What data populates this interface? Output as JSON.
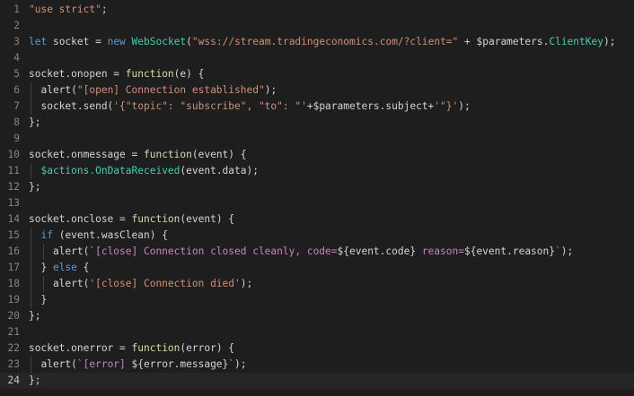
{
  "editor": {
    "language": "javascript",
    "active_line": 24,
    "colors": {
      "background": "#1e1e1e",
      "text": "#d4d4d4",
      "string": "#ce9178",
      "keyword": "#569cd6",
      "function": "#dcdcaa",
      "class": "#4ec9b0",
      "template_text": "#c586c0",
      "line_number": "#858585"
    },
    "lines": [
      {
        "n": 1,
        "guides": [],
        "tokens": [
          {
            "t": "\"use strict\"",
            "c": "str"
          },
          {
            "t": ";",
            "c": ""
          }
        ]
      },
      {
        "n": 2,
        "guides": [],
        "tokens": []
      },
      {
        "n": 3,
        "guides": [],
        "tokens": [
          {
            "t": "let",
            "c": "kw"
          },
          {
            "t": " socket = ",
            "c": ""
          },
          {
            "t": "new",
            "c": "kw"
          },
          {
            "t": " ",
            "c": ""
          },
          {
            "t": "WebSocket",
            "c": "cls"
          },
          {
            "t": "(",
            "c": ""
          },
          {
            "t": "\"wss://stream.tradingeconomics.com/?client=\"",
            "c": "str"
          },
          {
            "t": " + $parameters.",
            "c": ""
          },
          {
            "t": "ClientKey",
            "c": "prop"
          },
          {
            "t": ");",
            "c": ""
          }
        ]
      },
      {
        "n": 4,
        "guides": [],
        "tokens": []
      },
      {
        "n": 5,
        "guides": [],
        "tokens": [
          {
            "t": "socket.onopen = ",
            "c": ""
          },
          {
            "t": "function",
            "c": "fn"
          },
          {
            "t": "(e) {",
            "c": ""
          }
        ]
      },
      {
        "n": 6,
        "guides": [
          1
        ],
        "tokens": [
          {
            "t": "  alert(",
            "c": ""
          },
          {
            "t": "\"[open] Connection established\"",
            "c": "str"
          },
          {
            "t": ");",
            "c": ""
          }
        ]
      },
      {
        "n": 7,
        "guides": [
          1
        ],
        "tokens": [
          {
            "t": "  socket.send(",
            "c": ""
          },
          {
            "t": "'{\"topic\": \"subscribe\", \"to\": \"'",
            "c": "str"
          },
          {
            "t": "+$parameters.subject+",
            "c": ""
          },
          {
            "t": "'\"}'",
            "c": "str"
          },
          {
            "t": ");",
            "c": ""
          }
        ]
      },
      {
        "n": 8,
        "guides": [],
        "tokens": [
          {
            "t": "};",
            "c": ""
          }
        ]
      },
      {
        "n": 9,
        "guides": [],
        "tokens": []
      },
      {
        "n": 10,
        "guides": [],
        "tokens": [
          {
            "t": "socket.onmessage = ",
            "c": ""
          },
          {
            "t": "function",
            "c": "fn"
          },
          {
            "t": "(event) {",
            "c": ""
          }
        ]
      },
      {
        "n": 11,
        "guides": [
          1
        ],
        "tokens": [
          {
            "t": "  ",
            "c": ""
          },
          {
            "t": "$actions.OnDataReceived",
            "c": "cls"
          },
          {
            "t": "(event.data);",
            "c": ""
          }
        ]
      },
      {
        "n": 12,
        "guides": [],
        "tokens": [
          {
            "t": "};",
            "c": ""
          }
        ]
      },
      {
        "n": 13,
        "guides": [],
        "tokens": []
      },
      {
        "n": 14,
        "guides": [],
        "tokens": [
          {
            "t": "socket.onclose = ",
            "c": ""
          },
          {
            "t": "function",
            "c": "fn"
          },
          {
            "t": "(event) {",
            "c": ""
          }
        ]
      },
      {
        "n": 15,
        "guides": [
          1
        ],
        "tokens": [
          {
            "t": "  ",
            "c": ""
          },
          {
            "t": "if",
            "c": "kw"
          },
          {
            "t": " (event.wasClean) {",
            "c": ""
          }
        ]
      },
      {
        "n": 16,
        "guides": [
          1,
          2
        ],
        "tokens": [
          {
            "t": "    alert(",
            "c": ""
          },
          {
            "t": "`[close] Connection closed cleanly, code=",
            "c": "tpl"
          },
          {
            "t": "${event.code}",
            "c": ""
          },
          {
            "t": " reason=",
            "c": "tpl"
          },
          {
            "t": "${event.reason}",
            "c": ""
          },
          {
            "t": "`",
            "c": "tpl"
          },
          {
            "t": ");",
            "c": ""
          }
        ]
      },
      {
        "n": 17,
        "guides": [
          1
        ],
        "tokens": [
          {
            "t": "  } ",
            "c": ""
          },
          {
            "t": "else",
            "c": "kw"
          },
          {
            "t": " {",
            "c": ""
          }
        ]
      },
      {
        "n": 18,
        "guides": [
          1,
          2
        ],
        "tokens": [
          {
            "t": "    alert(",
            "c": ""
          },
          {
            "t": "'[close] Connection died'",
            "c": "str"
          },
          {
            "t": ");",
            "c": ""
          }
        ]
      },
      {
        "n": 19,
        "guides": [
          1
        ],
        "tokens": [
          {
            "t": "  }",
            "c": ""
          }
        ]
      },
      {
        "n": 20,
        "guides": [],
        "tokens": [
          {
            "t": "};",
            "c": ""
          }
        ]
      },
      {
        "n": 21,
        "guides": [],
        "tokens": []
      },
      {
        "n": 22,
        "guides": [],
        "tokens": [
          {
            "t": "socket.onerror = ",
            "c": ""
          },
          {
            "t": "function",
            "c": "fn"
          },
          {
            "t": "(error) {",
            "c": ""
          }
        ]
      },
      {
        "n": 23,
        "guides": [
          1
        ],
        "tokens": [
          {
            "t": "  alert(",
            "c": ""
          },
          {
            "t": "`[error] ",
            "c": "tpl"
          },
          {
            "t": "${error.message}",
            "c": ""
          },
          {
            "t": "`",
            "c": "tpl"
          },
          {
            "t": ");",
            "c": ""
          }
        ]
      },
      {
        "n": 24,
        "guides": [],
        "tokens": [
          {
            "t": "};",
            "c": ""
          }
        ]
      }
    ]
  }
}
